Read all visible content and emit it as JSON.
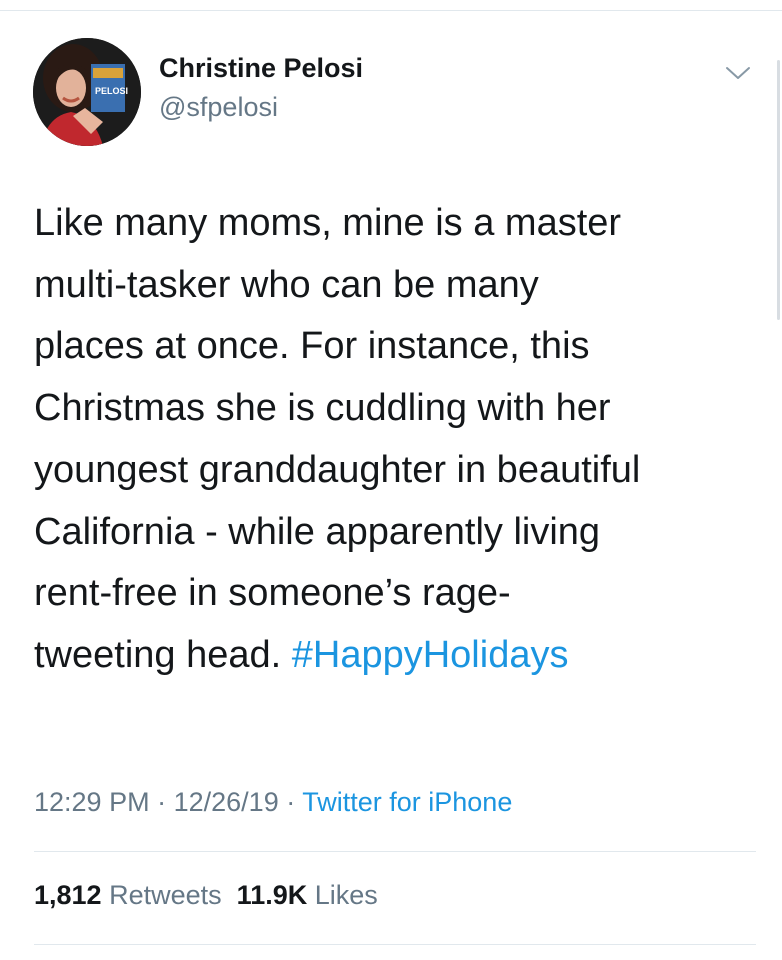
{
  "tweet": {
    "author": {
      "display_name": "Christine Pelosi",
      "handle": "@sfpelosi",
      "avatar_book_text": "PELOSI"
    },
    "text_lines": [
      "Like many moms, mine is a master",
      "multi-tasker who can be many",
      "places at once. For instance, this",
      "Christmas she is cuddling with her",
      "youngest granddaughter in beautiful",
      "California - while apparently living",
      "rent-free in someone’s rage-",
      "tweeting head. "
    ],
    "hashtag": "#HappyHolidays",
    "time": "12:29 PM",
    "date": "12/26/19",
    "separator": "·",
    "source": "Twitter for iPhone",
    "retweets": {
      "count": "1,812",
      "label": "Retweets"
    },
    "likes": {
      "count": "11.9K",
      "label": "Likes"
    }
  },
  "icons": {
    "menu": "chevron-down-icon"
  },
  "colors": {
    "link_blue": "#1b95e0",
    "secondary_text": "#657786",
    "primary_text": "#14171a",
    "divider": "#e1e8ed"
  }
}
